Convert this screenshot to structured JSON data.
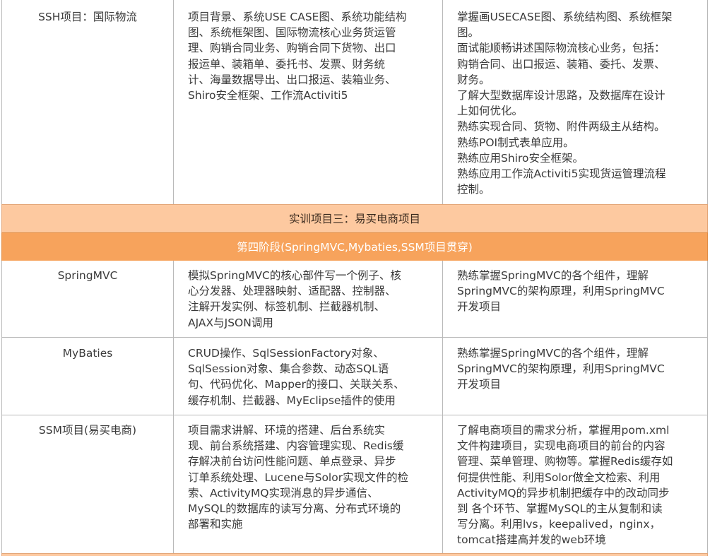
{
  "rows": [
    {
      "name": "SSH项目：国际物流",
      "content": [
        "项目背景、系统USE CASE图、系统功能结构",
        "图、系统框架图、国际物流核心业务货运管",
        "理、购销合同业务、购销合同下货物、出口",
        "报运单、装箱单、委托书、发票、财务统",
        "计、海量数据导出、出口报运、装箱业务、",
        "Shiro安全框架、工作流Activiti5"
      ],
      "goals": [
        "掌握画USECASE图、系统结构图、系统框架",
        "图。",
        "面试能顺畅讲述国际物流核心业务，包括：",
        "购销合同、出口报运、装箱、委托、发票、",
        "财务。",
        "了解大型数据库设计思路，及数据库在设计",
        "上如何优化。",
        "熟练实现合同、货物、附件两级主从结构。",
        "熟练POI制式表单应用。",
        "熟练应用Shiro安全框架。",
        "熟练应用工作流Activiti5实现货运管理流程",
        "控制。"
      ]
    },
    {
      "name": "SpringMVC",
      "content": [
        "模拟SpringMVC的核心部件写一个例子、核",
        "心分发器、处理器映射、适配器、控制器、",
        "注解开发实例、标签机制、拦截器机制、",
        "AJAX与JSON调用"
      ],
      "goals": [
        "熟练掌握SpringMVC的各个组件，理解",
        "SpringMVC的架构原理，利用SpringMVC",
        "开发项目"
      ]
    },
    {
      "name": "MyBaties",
      "content": [
        "CRUD操作、SqlSessionFactory对象、",
        "SqlSession对象、集合参数、动态SQL语",
        "句、代码优化、Mapper的接口、关联关系、",
        "缓存机制、拦截器、MyEclipse插件的使用"
      ],
      "goals": [
        "熟练掌握SpringMVC的各个组件，理解",
        "SpringMVC的架构原理，利用SpringMVC",
        "开发项目"
      ]
    },
    {
      "name": "SSM项目(易买电商)",
      "content": [
        "项目需求讲解、环境的搭建、后台系统实",
        "现、前台系统搭建、内容管理实现、Redis缓",
        "存解决前台访问性能问题、单点登录、异步",
        "订单系统处理、Lucene与Solor实现文件的检",
        "索、ActivityMQ实现消息的异步通信、",
        "MySQL的数据库的读写分离、分布式环境的",
        "部署和实施"
      ],
      "goals": [
        "了解电商项目的需求分析，掌握用pom.xml",
        "文件构建项目，实现电商项目的前台的内容",
        "管理、菜单管理、购物等。掌握Redis缓存如",
        "何提供性能、利用Solor做全文检索、利用",
        "ActivityMQ的异步机制把缓存中的改动同步",
        "到 各个环节、掌握MySQL的主从复制和读",
        "写分离。利用lvs，keepalived，nginx，",
        "tomcat搭建高并发的web环境"
      ]
    }
  ],
  "section_banner": "实训项目三：易买电商项目",
  "stage_banner": "第四阶段(SpringMVC,Mybaties,SSM项目贯穿)",
  "colors": {
    "banner_light": "#fdc9a0",
    "banner_dark": "#f7a35c",
    "border": "#b9b9b9",
    "text": "#3a3a3a"
  }
}
